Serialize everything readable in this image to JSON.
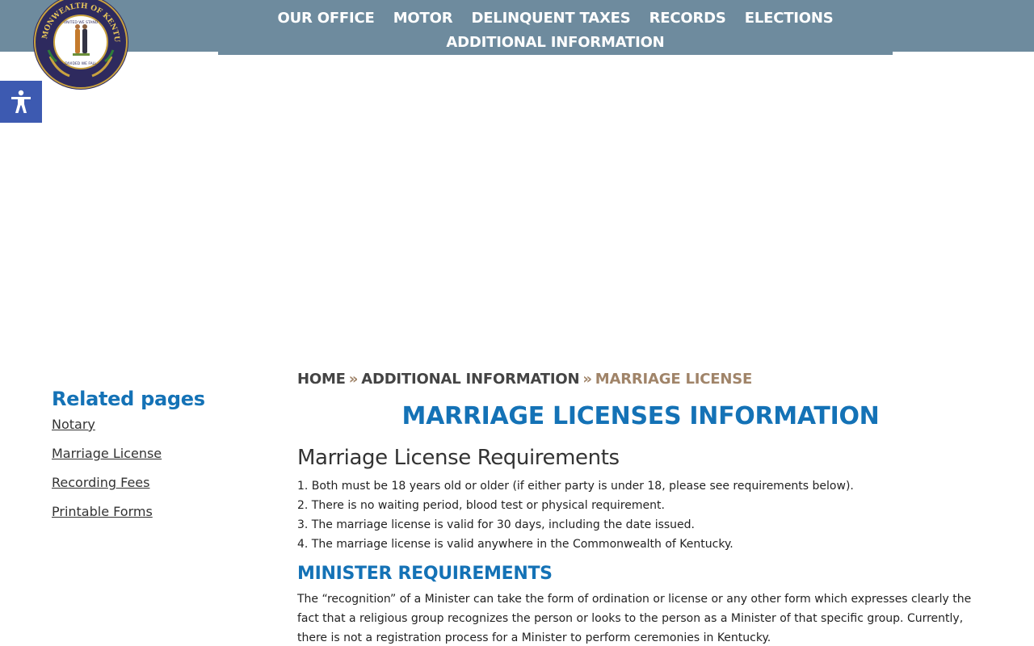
{
  "header": {
    "nav": [
      {
        "label": "OUR OFFICE"
      },
      {
        "label": "MOTOR"
      },
      {
        "label": "DELINQUENT TAXES"
      },
      {
        "label": "RECORDS"
      },
      {
        "label": "ELECTIONS"
      },
      {
        "label": "ADDITIONAL INFORMATION"
      }
    ],
    "seal": {
      "ring_text": "COMMONWEALTH OF KENTUCKY",
      "top_text": "UNITED WE STAND",
      "bottom_text": "DIVIDED WE FALL"
    },
    "bar_color": "#6e8b9e"
  },
  "accessibility_button": {
    "icon": "accessibility-icon",
    "color": "#3d5ab1"
  },
  "sidebar": {
    "title": "Related pages",
    "links": [
      {
        "label": "Notary"
      },
      {
        "label": "Marriage License"
      },
      {
        "label": "Recording Fees"
      },
      {
        "label": "Printable Forms"
      }
    ]
  },
  "breadcrumb": {
    "home": "HOME",
    "separator": "»",
    "parent": "ADDITIONAL INFORMATION",
    "current": "MARRIAGE LICENSE"
  },
  "main": {
    "title": "MARRIAGE LICENSES INFORMATION",
    "requirements_heading": "Marriage License Requirements",
    "requirements": [
      "1. Both must be 18 years old or older (if either party is under 18, please see requirements below).",
      "2. There is no waiting period, blood test or physical requirement.",
      "3. The marriage license is valid for 30 days, including the date issued.",
      "4. The marriage license is valid anywhere in the Commonwealth of Kentucky."
    ],
    "minister_heading": "MINISTER REQUIREMENTS",
    "minister_text": "The “recognition” of a Minister can take the form of ordination or license or any other form which expresses clearly the fact that a religious group recognizes the person or looks to the person as a Minister of that specific group. Currently, there is not a registration process for a Minister to perform ceremonies in Kentucky."
  },
  "colors": {
    "accent_blue": "#1472b6",
    "breadcrumb_current": "#a08469"
  }
}
